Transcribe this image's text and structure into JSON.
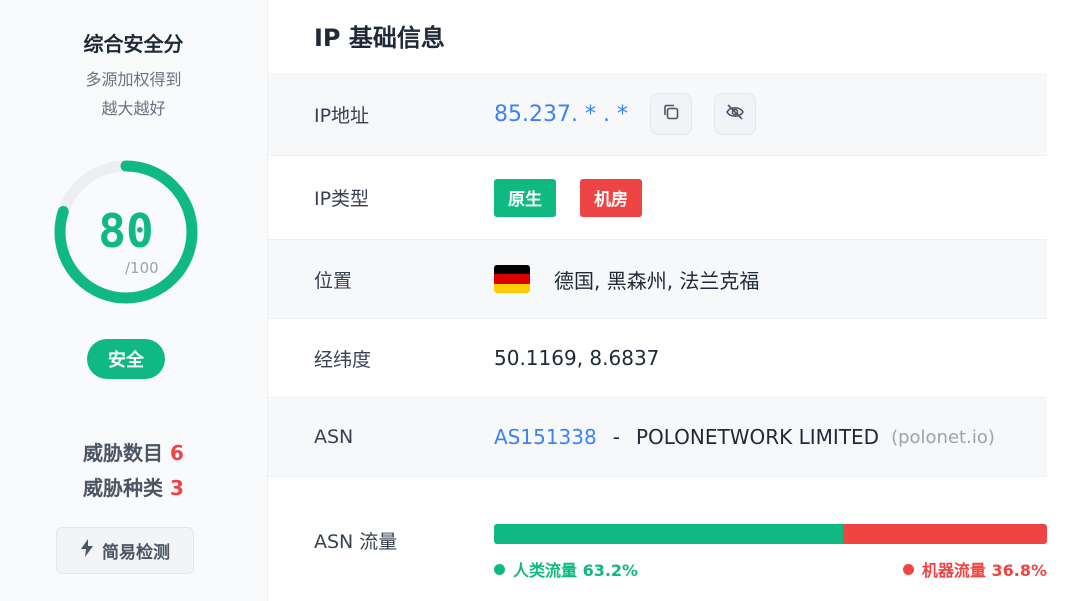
{
  "sidebar": {
    "title": "综合安全分",
    "subtitle_line1": "多源加权得到",
    "subtitle_line2": "越大越好",
    "score": "80",
    "score_max": "/100",
    "score_fraction": 0.8,
    "status_badge": "安全",
    "threat_count_label": "威胁数目",
    "threat_count": "6",
    "threat_types_label": "威胁种类",
    "threat_types": "3",
    "quick_check_label": "简易检测"
  },
  "main": {
    "title": "IP 基础信息",
    "ip": {
      "label": "IP地址",
      "value": "85.237. * . *"
    },
    "ip_type": {
      "label": "IP类型",
      "tags": [
        "原生",
        "机房"
      ]
    },
    "location": {
      "label": "位置",
      "value": "德国, 黑森州, 法兰克福"
    },
    "coords": {
      "label": "经纬度",
      "value": "50.1169, 8.6837"
    },
    "asn": {
      "label": "ASN",
      "number": "AS151338",
      "separator": "-",
      "org": "POLONETWORK LIMITED",
      "domain": "(polonet.io)"
    },
    "traffic": {
      "label": "ASN 流量",
      "human_label": "人类流量 63.2%",
      "bot_label": "机器流量 36.8%",
      "human_percent": 63.2,
      "bot_percent": 36.8
    }
  },
  "colors": {
    "accent_green": "#10b981",
    "accent_red": "#ef4444",
    "link_blue": "#3b82f6"
  },
  "icons": {
    "copy": "copy-icon",
    "hide": "eye-off-icon",
    "quick_check": "lightning-icon",
    "flag": "germany-flag-icon"
  }
}
